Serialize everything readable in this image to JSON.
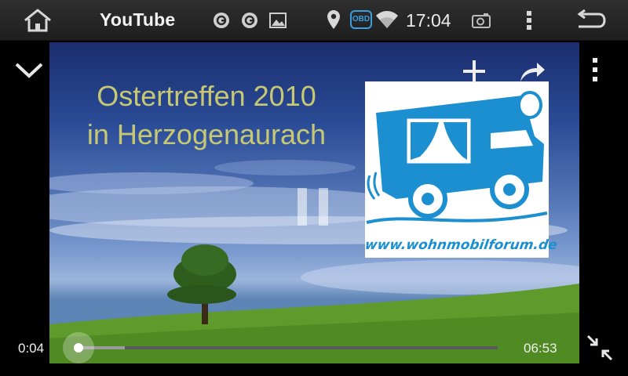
{
  "statusbar": {
    "app_title": "YouTube",
    "time": "17:04",
    "obd_label": "OBD",
    "icons": [
      "home-icon",
      "notification-app-icon",
      "notification-app-icon",
      "image-icon",
      "location-pin-icon",
      "obd-icon",
      "wifi-icon",
      "camera-icon",
      "overflow-menu-icon",
      "back-icon"
    ]
  },
  "video": {
    "title_line1": "Ostertreffen 2010",
    "title_line2": "in Herzogenaurach",
    "logo_url": "www.wohnmobilforum.de",
    "state": "playing"
  },
  "controls": {
    "current_time": "0:04",
    "duration": "06:53",
    "played_fraction": 0.0,
    "buffered_fraction": 0.11,
    "icons": [
      "chevron-down-icon",
      "add-icon",
      "share-icon",
      "more-vertical-icon",
      "pause-icon",
      "exit-fullscreen-icon"
    ]
  },
  "colors": {
    "title_text": "#c7c874",
    "logo_blue": "#1c8fd0",
    "obd_blue": "#3aa0e0"
  }
}
